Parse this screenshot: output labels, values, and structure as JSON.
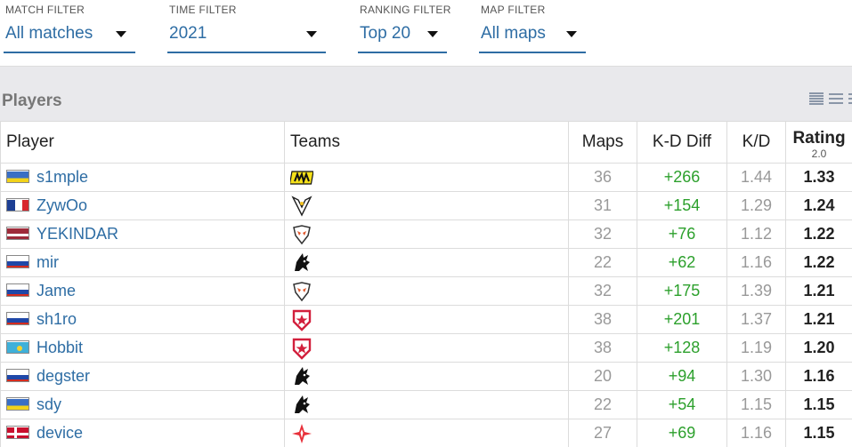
{
  "filters": [
    {
      "label": "MATCH FILTER",
      "value": "All matches"
    },
    {
      "label": "TIME FILTER",
      "value": "2021"
    },
    {
      "label": "RANKING FILTER",
      "value": "Top 20"
    },
    {
      "label": "MAP FILTER",
      "value": "All maps"
    }
  ],
  "section_title": "Players",
  "columns": {
    "player": "Player",
    "teams": "Teams",
    "maps": "Maps",
    "kd_diff": "K-D Diff",
    "kd": "K/D",
    "rating": "Rating",
    "rating_version": "2.0"
  },
  "rows": [
    {
      "player": "s1mple",
      "flag": "ukraine",
      "team_icon": "navi-logo-icon",
      "maps": "36",
      "kd_diff": "+266",
      "kd": "1.44",
      "rating": "1.33"
    },
    {
      "player": "ZywOo",
      "flag": "france",
      "team_icon": "vitality-logo-icon",
      "maps": "31",
      "kd_diff": "+154",
      "kd": "1.29",
      "rating": "1.24"
    },
    {
      "player": "YEKINDAR",
      "flag": "latvia",
      "team_icon": "virtus-pro-logo-icon",
      "maps": "32",
      "kd_diff": "+76",
      "kd": "1.12",
      "rating": "1.22"
    },
    {
      "player": "mir",
      "flag": "russia",
      "team_icon": "spirit-logo-icon",
      "maps": "22",
      "kd_diff": "+62",
      "kd": "1.16",
      "rating": "1.22"
    },
    {
      "player": "Jame",
      "flag": "russia",
      "team_icon": "virtus-pro-logo-icon",
      "maps": "32",
      "kd_diff": "+175",
      "kd": "1.39",
      "rating": "1.21"
    },
    {
      "player": "sh1ro",
      "flag": "russia",
      "team_icon": "gambit-logo-icon",
      "maps": "38",
      "kd_diff": "+201",
      "kd": "1.37",
      "rating": "1.21"
    },
    {
      "player": "Hobbit",
      "flag": "kazakhstan",
      "team_icon": "gambit-logo-icon",
      "maps": "38",
      "kd_diff": "+128",
      "kd": "1.19",
      "rating": "1.20"
    },
    {
      "player": "degster",
      "flag": "russia",
      "team_icon": "spirit-logo-icon",
      "maps": "20",
      "kd_diff": "+94",
      "kd": "1.30",
      "rating": "1.16"
    },
    {
      "player": "sdy",
      "flag": "ukraine",
      "team_icon": "spirit-logo-icon",
      "maps": "22",
      "kd_diff": "+54",
      "kd": "1.15",
      "rating": "1.15"
    },
    {
      "player": "device",
      "flag": "denmark",
      "team_icon": "astralis-logo-icon",
      "maps": "27",
      "kd_diff": "+69",
      "kd": "1.16",
      "rating": "1.15"
    }
  ],
  "colors": {
    "link": "#2e6da4",
    "positive": "#2ca02c",
    "muted": "#999999",
    "band": "#e9e9ec"
  }
}
